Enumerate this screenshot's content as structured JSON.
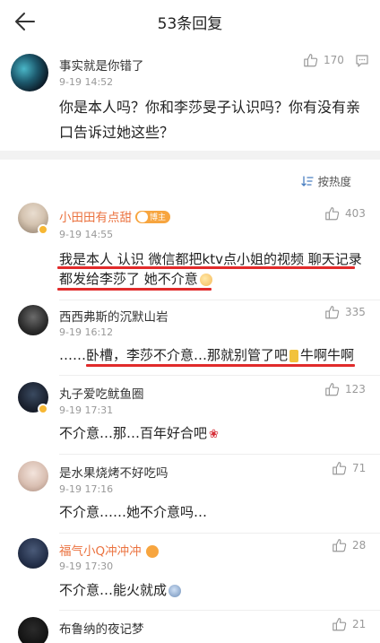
{
  "header": {
    "title": "53条回复",
    "back_icon": "arrow-left-icon"
  },
  "main_comment": {
    "name": "事实就是你错了",
    "time": "9-19 14:52",
    "likes": "170",
    "text": "你是本人吗？你和李莎旻子认识吗？你有没有亲口告诉过她这些？"
  },
  "sort": {
    "label": "按热度",
    "icon": "sort-icon"
  },
  "replies": [
    {
      "name": "小田田有点甜",
      "badge": "博主",
      "time": "9-19 14:55",
      "likes": "403",
      "line1": "我是本人 认识 微信都把ktv点小姐的视频 聊天记录",
      "line2": "都发给李莎了 她不介意"
    },
    {
      "name": "西西弗斯的沉默山岩",
      "time": "9-19 16:12",
      "likes": "335",
      "text": "……卧槽，李莎不介意…那就别管了吧",
      "tail": "牛啊牛啊"
    },
    {
      "name": "丸子爱吃鱿鱼圈",
      "time": "9-19 17:31",
      "likes": "123",
      "text": "不介意…那…百年好合吧"
    },
    {
      "name": "是水果烧烤不好吃吗",
      "time": "9-19 17:16",
      "likes": "71",
      "text": "不介意……她不介意吗…"
    },
    {
      "name": "福气小Q冲冲冲",
      "time": "9-19 17:30",
      "likes": "28",
      "text": "不介意…能火就成"
    },
    {
      "name": "布鲁纳的夜记梦",
      "likes": "21"
    }
  ],
  "colors": {
    "accent_orange": "#eb7340",
    "highlight_red": "#e12b2b",
    "divider": "#f2f2f2"
  }
}
